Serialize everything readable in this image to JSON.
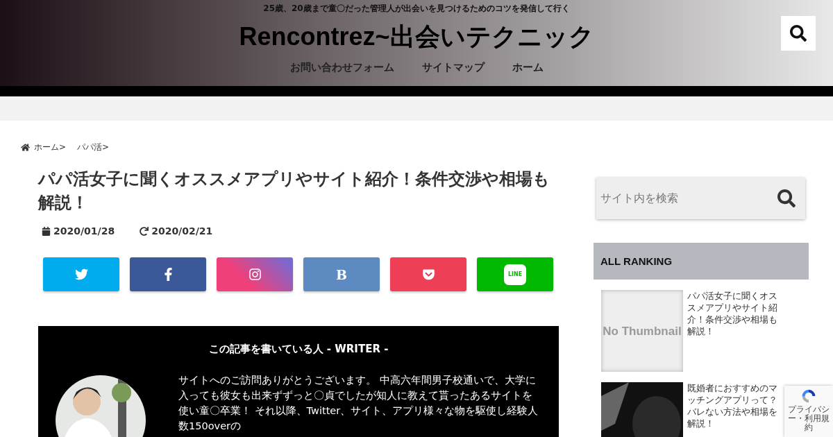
{
  "header": {
    "tagline": "25歳、20歳まで童〇だった管理人が出会いを見つけるためのコツを発信して行く",
    "logo": "Rencontrez~出会いテクニック",
    "nav": [
      "お問い合わせフォーム",
      "サイトマップ",
      "ホーム"
    ]
  },
  "breadcrumb": [
    "ホーム>",
    "パパ活>"
  ],
  "article": {
    "title": "パパ活女子に聞くオススメアプリやサイト紹介！条件交渉や相場も解説！",
    "published": "2020/01/28",
    "updated": "2020/02/21",
    "share": [
      {
        "kind": "twitter"
      },
      {
        "kind": "facebook"
      },
      {
        "kind": "instagram"
      },
      {
        "kind": "hatena",
        "label": "B"
      },
      {
        "kind": "pocket"
      },
      {
        "kind": "line",
        "label": "LINE"
      }
    ],
    "writer": {
      "heading": "この記事を書いている人 - **WRITER** -",
      "bio": "サイトへのご訪問ありがとうございます。 中高六年間男子校通いで、大学に入っても彼女も出来ずずっと〇貞でしたが知人に教えて貰ったあるサイトを使い童〇卒業！ それ以降、Twitter、サイト、アプリ様々な物を駆使し経験人数150overの"
    }
  },
  "sidebar": {
    "search": {
      "placeholder": "サイト内を検索"
    },
    "ranking": {
      "title": "ALL RANKING",
      "items": [
        {
          "kind": "no_thumbnail",
          "thumb_text": "No Thumbnail",
          "title": "パパ活女子に聞くオススメアプリやサイト紹介！条件交渉や相場も解説！"
        },
        {
          "kind": "picture",
          "title": "既婚者におすすめのマッチングアプリって？バレない方法や相場を解説！"
        }
      ]
    }
  },
  "recaptcha": {
    "terms": "プライバシー・利用規約"
  }
}
